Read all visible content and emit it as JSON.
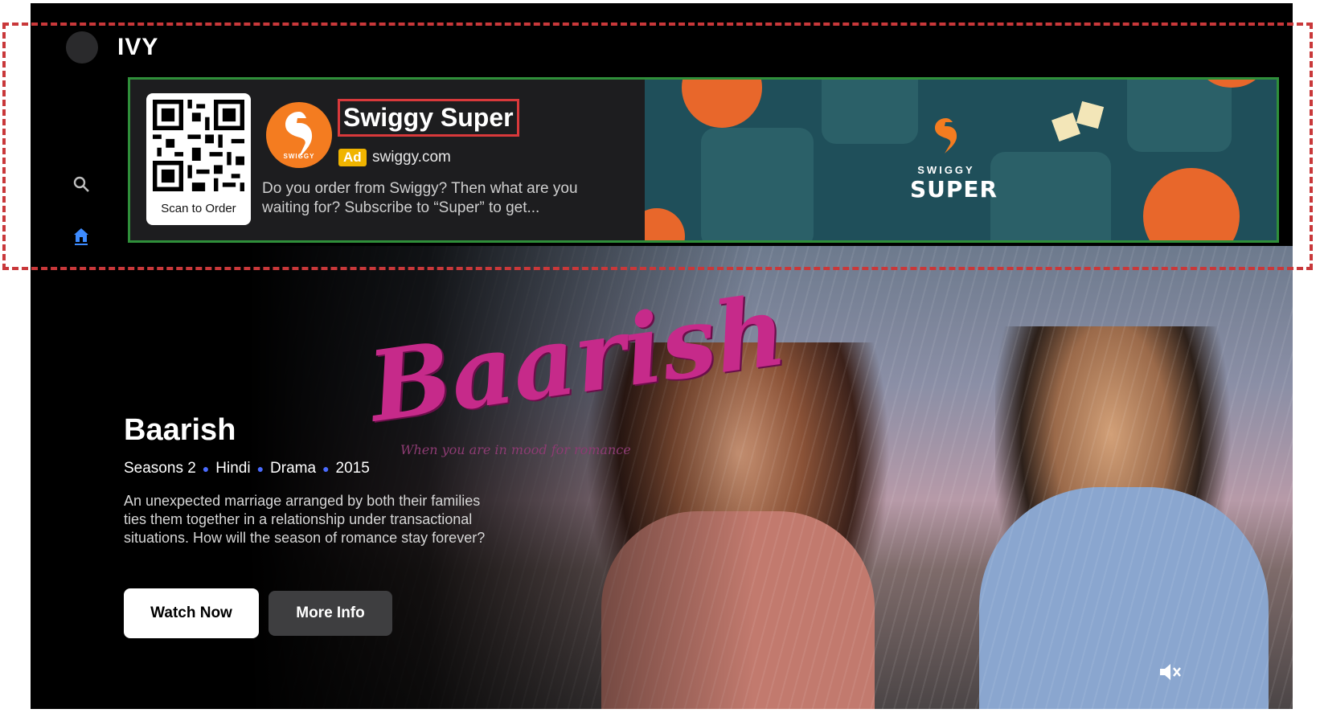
{
  "app": {
    "brand": "IVY"
  },
  "ad": {
    "title": "Swiggy Super",
    "badge": "Ad",
    "domain": "swiggy.com",
    "description": "Do you order from Swiggy? Then what are you waiting for? Subscribe to “Super” to get...",
    "qr_caption": "Scan to Order",
    "logo_text": "SWIGGY",
    "art_small": "SWIGGY",
    "art_big": "SUPER",
    "border_color": "#2f8f3a",
    "brand_color": "#f47c20"
  },
  "sidebar": {
    "items": [
      {
        "icon": "search-icon"
      },
      {
        "icon": "home-icon",
        "active": true
      },
      {
        "icon": "sports-icon"
      },
      {
        "icon": "movies-icon"
      },
      {
        "icon": "tv-icon"
      },
      {
        "icon": "watchlist-icon"
      },
      {
        "icon": "settings-icon"
      }
    ],
    "active_color": "#3d8bff"
  },
  "hero": {
    "title": "Baarish",
    "meta": [
      "Seasons 2",
      "Hindi",
      "Drama",
      "2015"
    ],
    "description": "An unexpected marriage arranged by both their families ties them together in a relationship under transactional situations. How will the season of romance stay forever?",
    "watch_label": "Watch Now",
    "info_label": "More Info",
    "logo_art": "Baarish",
    "logo_tagline": "When you are in mood for romance"
  }
}
